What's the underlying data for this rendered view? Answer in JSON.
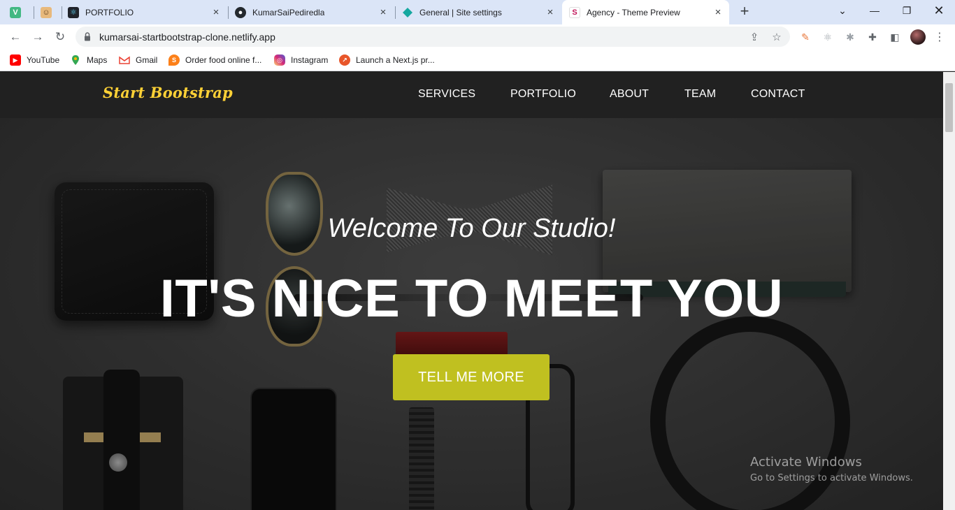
{
  "browser": {
    "tabs": [
      {
        "title": "",
        "icon": "vue-icon"
      },
      {
        "title": "",
        "icon": "avatar-emoji-icon"
      },
      {
        "title": "PORTFOLIO",
        "icon": "react-icon"
      },
      {
        "title": "KumarSaiPediredla",
        "icon": "github-icon"
      },
      {
        "title": "General | Site settings",
        "icon": "netlify-icon"
      },
      {
        "title": "Agency - Theme Preview",
        "icon": "startbootstrap-icon",
        "active": true
      }
    ],
    "url": "kumarsai-startbootstrap-clone.netlify.app",
    "bookmarks": [
      {
        "label": "YouTube",
        "icon": "youtube-icon"
      },
      {
        "label": "Maps",
        "icon": "maps-icon"
      },
      {
        "label": "Gmail",
        "icon": "gmail-icon"
      },
      {
        "label": "Order food online f...",
        "icon": "swiggy-icon"
      },
      {
        "label": "Instagram",
        "icon": "instagram-icon"
      },
      {
        "label": "Launch a Next.js pr...",
        "icon": "nextjs-icon"
      }
    ]
  },
  "site": {
    "brand": "Start Bootstrap",
    "nav": [
      "SERVICES",
      "PORTFOLIO",
      "ABOUT",
      "TEAM",
      "CONTACT"
    ],
    "hero": {
      "lead": "Welcome To Our Studio!",
      "heading": "IT'S NICE TO MEET YOU",
      "cta": "TELL ME MORE"
    }
  },
  "watermark": {
    "line1": "Activate Windows",
    "line2": "Go to Settings to activate Windows."
  },
  "colors": {
    "brand": "#fed136",
    "cta": "#c0c020",
    "navbar": "#212121",
    "tabstrip": "#dbe5f7"
  }
}
